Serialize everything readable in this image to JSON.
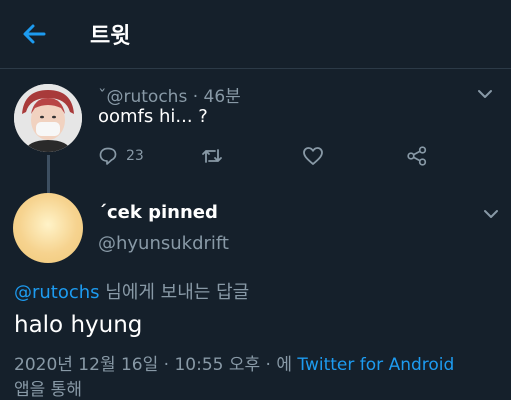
{
  "header": {
    "title": "트윗"
  },
  "parent_tweet": {
    "handle": "ˇ@rutochs",
    "separator": "·",
    "time": "46분",
    "text": "oomfs hi... ?",
    "reply_count": "23"
  },
  "reply_tweet": {
    "display_name": "ˊcek pinned",
    "handle": "@hyunsukdrift"
  },
  "replying_to": {
    "mention": "@rutochs",
    "suffix": " 님에게 보내는 답글"
  },
  "reply_text": "halo hyung",
  "timestamp": {
    "date_time": "2020년 12월 16일 · 10:55 오후 · 에 ",
    "source": "Twitter for Android",
    "suffix": "앱을 통해"
  },
  "colors": {
    "background": "#15202b",
    "accent": "#1d9bf0",
    "secondary_text": "#8899a6"
  }
}
